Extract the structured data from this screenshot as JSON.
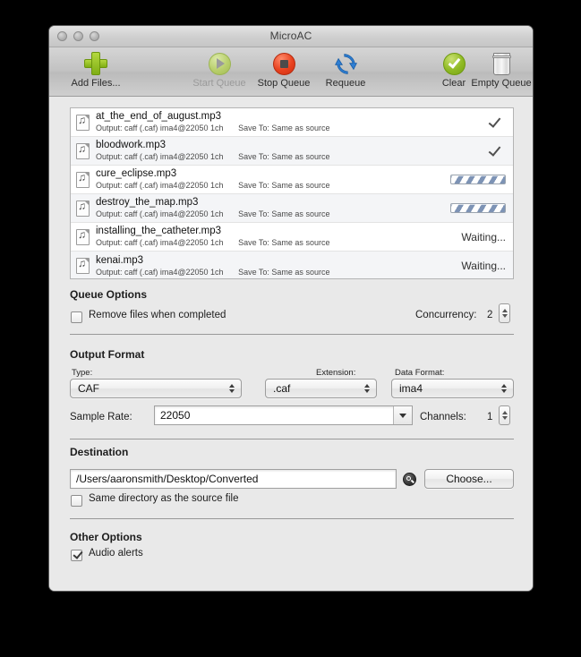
{
  "window": {
    "title": "MicroAC"
  },
  "toolbar": {
    "items": [
      {
        "label": "Add Files...",
        "icon": "plus-icon",
        "enabled": true
      },
      {
        "label": "Start Queue",
        "icon": "play-icon",
        "enabled": false
      },
      {
        "label": "Stop Queue",
        "icon": "stop-icon",
        "enabled": true
      },
      {
        "label": "Requeue",
        "icon": "refresh-icon",
        "enabled": true
      },
      {
        "label": "Clear",
        "icon": "checkmark-circle-icon",
        "enabled": true
      },
      {
        "label": "Empty Queue",
        "icon": "trash-icon",
        "enabled": true
      }
    ]
  },
  "file_list": {
    "rows": [
      {
        "name": "at_the_end_of_august.mp3",
        "output": "Output: caff (.caf) ima4@22050 1ch",
        "save_to": "Save To: Same as source",
        "status_type": "done",
        "status_text": ""
      },
      {
        "name": "bloodwork.mp3",
        "output": "Output: caff (.caf) ima4@22050 1ch",
        "save_to": "Save To: Same as source",
        "status_type": "done",
        "status_text": ""
      },
      {
        "name": "cure_eclipse.mp3",
        "output": "Output: caff (.caf) ima4@22050 1ch",
        "save_to": "Save To: Same as source",
        "status_type": "progress",
        "status_text": ""
      },
      {
        "name": "destroy_the_map.mp3",
        "output": "Output: caff (.caf) ima4@22050 1ch",
        "save_to": "Save To: Same as source",
        "status_type": "progress",
        "status_text": ""
      },
      {
        "name": "installing_the_catheter.mp3",
        "output": "Output: caff (.caf) ima4@22050 1ch",
        "save_to": "Save To: Same as source",
        "status_type": "text",
        "status_text": "Waiting..."
      },
      {
        "name": "kenai.mp3",
        "output": "Output: caff (.caf) ima4@22050 1ch",
        "save_to": "Save To: Same as source",
        "status_type": "text",
        "status_text": "Waiting..."
      }
    ]
  },
  "queue_options": {
    "title": "Queue Options",
    "remove_files_label": "Remove files when completed",
    "remove_files_checked": false,
    "concurrency_label": "Concurrency:",
    "concurrency_value": "2"
  },
  "output_format": {
    "title": "Output Format",
    "type_label": "Type:",
    "type_value": "CAF",
    "extension_label": "Extension:",
    "extension_value": ".caf",
    "data_format_label": "Data Format:",
    "data_format_value": "ima4",
    "sample_rate_label": "Sample Rate:",
    "sample_rate_value": "22050",
    "channels_label": "Channels:",
    "channels_value": "1"
  },
  "destination": {
    "title": "Destination",
    "path_value": "/Users/aaronsmith/Desktop/Converted",
    "choose_label": "Choose...",
    "same_dir_label": "Same directory as the source file",
    "same_dir_checked": false
  },
  "other_options": {
    "title": "Other Options",
    "audio_alerts_label": "Audio alerts",
    "audio_alerts_checked": true
  }
}
